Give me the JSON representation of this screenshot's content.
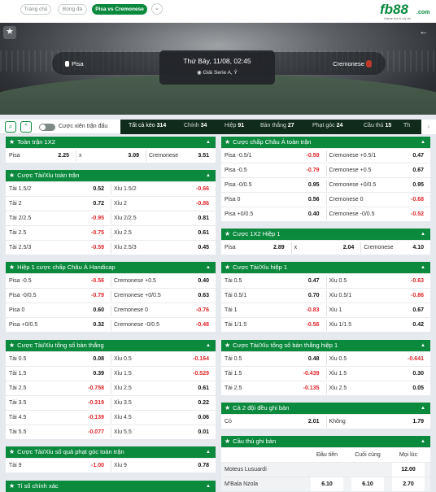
{
  "breadcrumbs": [
    "Trang chủ",
    "Bóng đá",
    "Pisa vs Cremonese"
  ],
  "logo": {
    "text": "fb88",
    "domain": ".com",
    "tagline": "Game hot & Uy tín"
  },
  "match": {
    "home": "Pisa",
    "away": "Cremonese",
    "date": "Thứ Bảy, 11/08, 02:45",
    "league": "Giải Serie A, Ý"
  },
  "toolbar": {
    "search_icon": "search-icon",
    "collapse_icon": "double-chevron-up-icon",
    "live_toggle_label": "Cược xiên trận đấu"
  },
  "filters": [
    {
      "label": "Tất cả kèo",
      "count": "314"
    },
    {
      "label": "Chính",
      "count": "34"
    },
    {
      "label": "Hiệp",
      "count": "91"
    },
    {
      "label": "Bàn thắng",
      "count": "27"
    },
    {
      "label": "Phạt góc",
      "count": "24"
    },
    {
      "label": "Cầu thủ",
      "count": "15"
    },
    {
      "label": "Th",
      "count": ""
    }
  ],
  "colors": {
    "brand_green": "#0b8a3e",
    "negative": "#e1252a",
    "filter_bar": "#102b1c"
  },
  "markets_left": [
    {
      "title": "Toàn trận 1X2",
      "type": "three",
      "rows": [
        [
          [
            "Pisa",
            "2.25"
          ],
          [
            "x",
            "3.09"
          ],
          [
            "Cremonese",
            "3.51"
          ]
        ]
      ]
    },
    {
      "title": "Cược Tài/Xỉu toàn trận",
      "type": "two",
      "rows": [
        [
          [
            "Tài 1.5/2",
            "0.52"
          ],
          [
            "Xỉu 1.5/2",
            "-0.66"
          ]
        ],
        [
          [
            "Tài 2",
            "0.72"
          ],
          [
            "Xỉu 2",
            "-0.86"
          ]
        ],
        [
          [
            "Tài 2/2.5",
            "-0.95"
          ],
          [
            "Xỉu 2/2.5",
            "0.81"
          ]
        ],
        [
          [
            "Tài 2.5",
            "-0.75"
          ],
          [
            "Xỉu 2.5",
            "0.61"
          ]
        ],
        [
          [
            "Tài 2.5/3",
            "-0.59"
          ],
          [
            "Xỉu 2.5/3",
            "0.45"
          ]
        ]
      ]
    },
    {
      "title": "Hiệp 1 cược chấp Châu Á Handicap",
      "type": "two",
      "rows": [
        [
          [
            "Pisa -0.5",
            "-0.56"
          ],
          [
            "Cremonese +0.5",
            "0.40"
          ]
        ],
        [
          [
            "Pisa -0/0.5",
            "-0.79"
          ],
          [
            "Cremonese +0/0.5",
            "0.63"
          ]
        ],
        [
          [
            "Pisa 0",
            "0.60"
          ],
          [
            "Cremonese 0",
            "-0.76"
          ]
        ],
        [
          [
            "Pisa +0/0.5",
            "0.32"
          ],
          [
            "Cremonese -0/0.5",
            "-0.48"
          ]
        ]
      ]
    },
    {
      "title": "Cược Tài/Xỉu tổng số bàn thắng",
      "type": "two",
      "rows": [
        [
          [
            "Tài 0.5",
            "0.08"
          ],
          [
            "Xỉu 0.5",
            "-0.164"
          ]
        ],
        [
          [
            "Tài 1.5",
            "0.39"
          ],
          [
            "Xỉu 1.5",
            "-0.529"
          ]
        ],
        [
          [
            "Tài 2.5",
            "-0.758"
          ],
          [
            "Xỉu 2.5",
            "0.61"
          ]
        ],
        [
          [
            "Tài 3.5",
            "-0.319"
          ],
          [
            "Xỉu 3.5",
            "0.22"
          ]
        ],
        [
          [
            "Tài 4.5",
            "-0.139"
          ],
          [
            "Xỉu 4.5",
            "0.06"
          ]
        ],
        [
          [
            "Tài 5.5",
            "-0.077"
          ],
          [
            "Xỉu 5.5",
            "0.01"
          ]
        ]
      ]
    },
    {
      "title": "Cược Tài/Xỉu số quả phạt góc toàn trận",
      "type": "two",
      "rows": [
        [
          [
            "Tài 9",
            "-1.00"
          ],
          [
            "Xỉu 9",
            "0.78"
          ]
        ]
      ]
    },
    {
      "title": "Tỉ số chính xác",
      "type": "two",
      "rows": []
    }
  ],
  "markets_right": [
    {
      "title": "Cược chấp Châu Á toàn trận",
      "type": "two",
      "rows": [
        [
          [
            "Pisa -0.5/1",
            "-0.59"
          ],
          [
            "Cremonese +0.5/1",
            "0.47"
          ]
        ],
        [
          [
            "Pisa -0.5",
            "-0.79"
          ],
          [
            "Cremonese +0.5",
            "0.67"
          ]
        ],
        [
          [
            "Pisa -0/0.5",
            "0.95"
          ],
          [
            "Cremonese +0/0.5",
            "0.95"
          ]
        ],
        [
          [
            "Pisa 0",
            "0.56"
          ],
          [
            "Cremonese 0",
            "-0.68"
          ]
        ],
        [
          [
            "Pisa +0/0.5",
            "0.40"
          ],
          [
            "Cremonese -0/0.5",
            "-0.52"
          ]
        ]
      ]
    },
    {
      "title": "Cược 1X2 Hiệp 1",
      "type": "three",
      "rows": [
        [
          [
            "Pisa",
            "2.89"
          ],
          [
            "x",
            "2.04"
          ],
          [
            "Cremonese",
            "4.10"
          ]
        ]
      ]
    },
    {
      "title": "Cược Tài/Xỉu hiệp 1",
      "type": "two",
      "rows": [
        [
          [
            "Tài 0.5",
            "0.47"
          ],
          [
            "Xỉu 0.5",
            "-0.63"
          ]
        ],
        [
          [
            "Tài 0.5/1",
            "0.70"
          ],
          [
            "Xỉu 0.5/1",
            "-0.86"
          ]
        ],
        [
          [
            "Tài 1",
            "-0.83"
          ],
          [
            "Xỉu 1",
            "0.67"
          ]
        ],
        [
          [
            "Tài 1/1.5",
            "-0.56"
          ],
          [
            "Xỉu 1/1.5",
            "0.42"
          ]
        ]
      ]
    },
    {
      "title": "Cược Tài/Xỉu tổng số bàn thắng hiệp 1",
      "type": "two",
      "rows": [
        [
          [
            "Tài 0.5",
            "0.48"
          ],
          [
            "Xỉu 0.5",
            "-0.641"
          ]
        ],
        [
          [
            "Tài 1.5",
            "-0.439"
          ],
          [
            "Xỉu 1.5",
            "0.30"
          ]
        ],
        [
          [
            "Tài 2.5",
            "-0.135"
          ],
          [
            "Xỉu 2.5",
            "0.05"
          ]
        ]
      ]
    },
    {
      "title": "Cả 2 đội đều ghi bàn",
      "type": "two",
      "rows": [
        [
          [
            "Có",
            "2.01"
          ],
          [
            "Không",
            "1.79"
          ]
        ]
      ]
    },
    {
      "title": "Cầu thủ ghi bàn",
      "type": "scorer",
      "headers": [
        "Đầu tiên",
        "Cuối cùng",
        "Mọi lúc"
      ],
      "rows": [
        {
          "player": "Moteus Lusuardi",
          "values": [
            "",
            "",
            "12.00"
          ]
        },
        {
          "player": "M'Bala Nzola",
          "values": [
            "6.10",
            "6.10",
            "2.70"
          ]
        }
      ]
    }
  ]
}
